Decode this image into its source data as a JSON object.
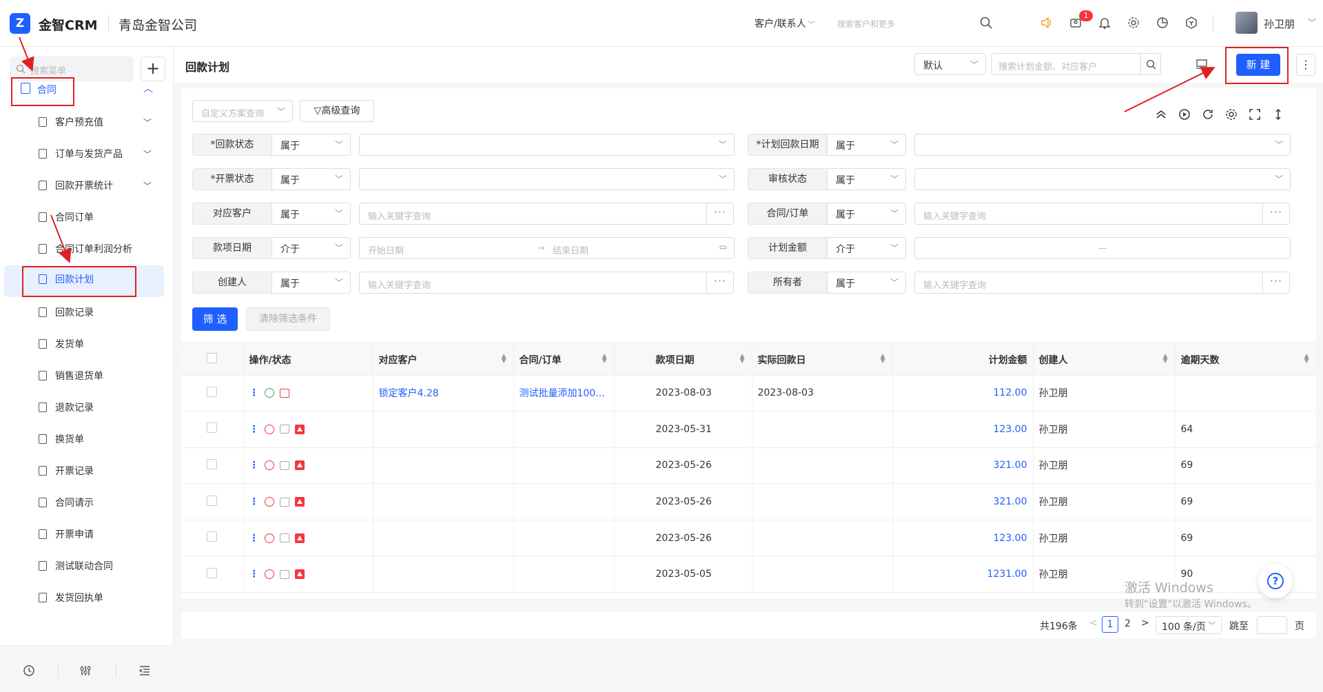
{
  "topbar": {
    "logo_mark": "Z",
    "app_name": "金智CRM",
    "company": "青岛金智公司",
    "search_type": "客户/联系人",
    "search_placeholder": "搜索客户和更多",
    "notification_count": "1",
    "username": "孙卫朋"
  },
  "sidebar": {
    "search_placeholder": "搜索菜单",
    "add_label": "+",
    "group_label": "合同",
    "items": [
      {
        "label": "客户预充值",
        "expandable": true
      },
      {
        "label": "订单与发货产品",
        "expandable": true
      },
      {
        "label": "回款开票统计",
        "expandable": true
      },
      {
        "label": "合同订单"
      },
      {
        "label": "合同订单利润分析"
      },
      {
        "label": "回款计划",
        "active": true
      },
      {
        "label": "回款记录"
      },
      {
        "label": "发货单"
      },
      {
        "label": "销售退货单"
      },
      {
        "label": "退款记录"
      },
      {
        "label": "换货单"
      },
      {
        "label": "开票记录"
      },
      {
        "label": "合同请示"
      },
      {
        "label": "开票申请"
      },
      {
        "label": "测试联动合同"
      },
      {
        "label": "发货回执单"
      }
    ]
  },
  "header": {
    "title": "回款计划",
    "view": "默认",
    "search_placeholder": "搜索计划金额、对应客户",
    "new_label": "新 建",
    "more_label": "⋮"
  },
  "filters": {
    "preset_placeholder": "自定义方案查询",
    "advanced_label": "高级查询",
    "rows": [
      {
        "label": "*回款状态",
        "op": "属于",
        "value_ph": "",
        "kind": "select"
      },
      {
        "label": "*计划回款日期",
        "op": "属于",
        "value_ph": "",
        "kind": "select"
      },
      {
        "label": "*开票状态",
        "op": "属于",
        "value_ph": "",
        "kind": "select"
      },
      {
        "label": "审核状态",
        "op": "属于",
        "value_ph": "",
        "kind": "select"
      },
      {
        "label": "对应客户",
        "op": "属于",
        "value_ph": "输入关键字查询",
        "kind": "lookup"
      },
      {
        "label": "合同/订单",
        "op": "属于",
        "value_ph": "输入关键字查询",
        "kind": "lookup"
      },
      {
        "label": "款项日期",
        "op": "介于",
        "start_ph": "开始日期",
        "end_ph": "结束日期",
        "kind": "date"
      },
      {
        "label": "计划金额",
        "op": "介于",
        "range_sep": "—",
        "kind": "range"
      },
      {
        "label": "创建人",
        "op": "属于",
        "value_ph": "输入关键字查询",
        "kind": "lookup"
      },
      {
        "label": "所有者",
        "op": "属于",
        "value_ph": "输入关键字查询",
        "kind": "lookup"
      }
    ],
    "filter_btn": "筛 选",
    "clear_btn": "清除筛选条件"
  },
  "table": {
    "columns": [
      "操作/状态",
      "对应客户",
      "合同/订单",
      "款项日期",
      "实际回款日",
      "计划金额",
      "创建人",
      "逾期天数"
    ],
    "rows": [
      {
        "customer": "锁定客户4.28",
        "contract": "测试批量添加100...",
        "date": "2023-08-03",
        "actual": "2023-08-03",
        "amount": "112.00",
        "creator": "孙卫朋",
        "overdue": "",
        "status": "green"
      },
      {
        "customer": "",
        "contract": "",
        "date": "2023-05-31",
        "actual": "",
        "amount": "123.00",
        "creator": "孙卫朋",
        "overdue": "64",
        "status": "red"
      },
      {
        "customer": "",
        "contract": "",
        "date": "2023-05-26",
        "actual": "",
        "amount": "321.00",
        "creator": "孙卫朋",
        "overdue": "69",
        "status": "red"
      },
      {
        "customer": "",
        "contract": "",
        "date": "2023-05-26",
        "actual": "",
        "amount": "321.00",
        "creator": "孙卫朋",
        "overdue": "69",
        "status": "red"
      },
      {
        "customer": "",
        "contract": "",
        "date": "2023-05-26",
        "actual": "",
        "amount": "123.00",
        "creator": "孙卫朋",
        "overdue": "69",
        "status": "red"
      },
      {
        "customer": "",
        "contract": "",
        "date": "2023-05-05",
        "actual": "",
        "amount": "1231.00",
        "creator": "孙卫朋",
        "overdue": "90",
        "status": "red"
      }
    ]
  },
  "pagination": {
    "total": "共196条",
    "prev": "<",
    "current": "1",
    "page2": "2",
    "next": ">",
    "page_size": "100 条/页",
    "jump_label": "跳至",
    "page_suffix": "页"
  },
  "watermark": {
    "line1": "激活 Windows",
    "line2": "转到\"设置\"以激活 Windows。"
  },
  "help_label": "?",
  "colors": {
    "primary": "#1f5eff",
    "danger": "#f5363d",
    "success": "#22b35e",
    "annotation": "#e02020"
  }
}
